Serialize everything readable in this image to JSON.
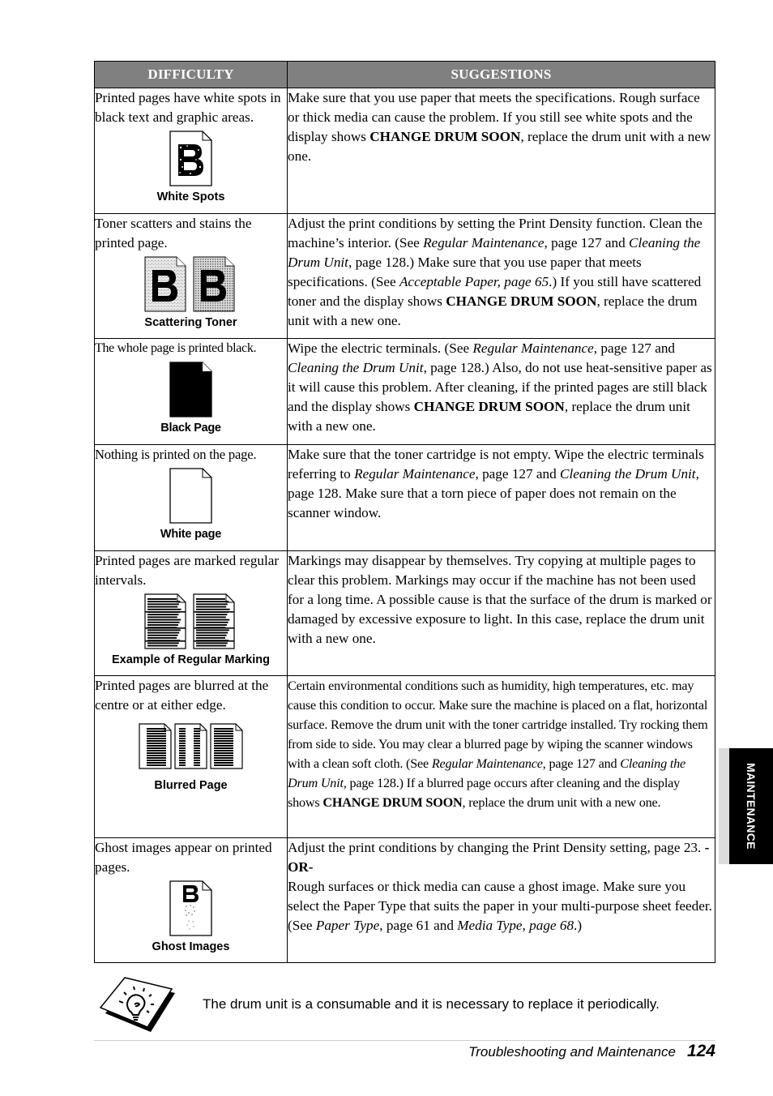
{
  "table": {
    "headers": {
      "difficulty": "DIFFICULTY",
      "suggestions": "SUGGESTIONS"
    },
    "rows": [
      {
        "difficulty": "Printed pages have white spots in black text and graphic areas.",
        "figure_caption": "White Spots",
        "figure_icon": "white-spots-page-icon",
        "suggestion": [
          {
            "t": "Make sure that you use paper that meets the specifications. Rough surface or thick media can cause the problem. If you still see white spots and the display shows "
          },
          {
            "t": "CHANGE DRUM SOON",
            "s": "b"
          },
          {
            "t": ", replace the drum unit with a new one."
          }
        ]
      },
      {
        "difficulty": "Toner scatters and stains the printed page.",
        "figure_caption": "Scattering Toner",
        "figure_icon": "scattering-toner-pages-icon",
        "suggestion": [
          {
            "t": "Adjust the print conditions by setting the Print Density function. Clean the machine’s interior. (See "
          },
          {
            "t": "Regular Maintenance",
            "s": "i"
          },
          {
            "t": ", page 127 and "
          },
          {
            "t": "Cleaning the Drum Unit",
            "s": "i"
          },
          {
            "t": ", page 128.) Make sure that you use paper that meets specifications. (See "
          },
          {
            "t": "Acceptable Paper, page 65",
            "s": "i"
          },
          {
            "t": ".) If you still have scattered toner and the display shows "
          },
          {
            "t": "CHANGE DRUM SOON",
            "s": "b"
          },
          {
            "t": ", replace the drum unit with a new one."
          }
        ]
      },
      {
        "difficulty": "The whole page is printed black.",
        "figure_caption": "Black Page",
        "figure_icon": "black-page-icon",
        "suggestion": [
          {
            "t": "Wipe the electric terminals. (See "
          },
          {
            "t": "Regular Maintenance",
            "s": "i"
          },
          {
            "t": ", page 127 and "
          },
          {
            "t": "Cleaning the Drum Unit",
            "s": "i"
          },
          {
            "t": ", page 128.) Also, do not use heat-sensitive paper as it will cause this problem. After cleaning, if the printed pages are still black and the display shows "
          },
          {
            "t": "CHANGE DRUM SOON",
            "s": "b"
          },
          {
            "t": ", replace the drum unit with a new one."
          }
        ]
      },
      {
        "difficulty": "Nothing is printed on the page.",
        "figure_caption": "White page",
        "figure_icon": "white-page-icon",
        "suggestion": [
          {
            "t": "Make sure that the toner cartridge is not empty. Wipe the electric terminals referring to "
          },
          {
            "t": "Regular Maintenance",
            "s": "i"
          },
          {
            "t": ", page 127 and "
          },
          {
            "t": "Cleaning the Drum Unit",
            "s": "i"
          },
          {
            "t": ", page 128. Make sure that a torn piece of paper does not remain on the scanner window."
          }
        ]
      },
      {
        "difficulty": "Printed pages are marked regular intervals.",
        "figure_caption": "Example of Regular Marking",
        "figure_icon": "regular-marking-pages-icon",
        "suggestion": [
          {
            "t": "Markings may disappear by themselves. Try copying at multiple pages to clear this problem. Markings may occur if the machine has not been used for a long time. A possible cause is that the surface of the drum is marked or damaged by excessive exposure to light. In this case, replace the drum unit with a new one."
          }
        ]
      },
      {
        "difficulty": "Printed pages are blurred at the centre or at either edge.",
        "figure_caption": "Blurred Page",
        "figure_icon": "blurred-pages-icon",
        "suggestion": [
          {
            "t": "Certain environmental conditions such as humidity, high temperatures, etc. may cause this condition to occur. Make sure the machine is placed on a flat, horizontal surface. Remove the drum unit with the toner cartridge installed. Try rocking them from side to side. You may clear a blurred page by wiping the scanner windows with a clean soft cloth. (See "
          },
          {
            "t": "Regular Maintenance",
            "s": "i"
          },
          {
            "t": ", page 127 and "
          },
          {
            "t": "Cleaning the Drum Unit",
            "s": "i"
          },
          {
            "t": ", page 128.) If a blurred page occurs after cleaning and the display shows "
          },
          {
            "t": "CHANGE DRUM SOON",
            "s": "b"
          },
          {
            "t": ", replace the drum unit with a new one."
          }
        ]
      },
      {
        "difficulty": "Ghost images appear on printed pages.",
        "figure_caption": "Ghost Images",
        "figure_icon": "ghost-image-page-icon",
        "suggestion": [
          {
            "t": "Adjust the print conditions by changing the Print Density setting, page 23. "
          },
          {
            "t": "-OR-",
            "s": "b"
          },
          {
            "t": "\n",
            "s": "br"
          },
          {
            "t": "Rough surfaces or thick media can cause a ghost image. Make sure you select the Paper Type that suits the paper in your multi-purpose sheet feeder. (See "
          },
          {
            "t": "Paper Type",
            "s": "i"
          },
          {
            "t": ", page 61 and "
          },
          {
            "t": "Media Type, page 68",
            "s": "i"
          },
          {
            "t": ".)"
          }
        ]
      }
    ]
  },
  "note": {
    "icon": "lightbulb-tip-icon",
    "text": "The drum unit is a consumable and it is necessary to replace it periodically."
  },
  "footer": {
    "section_title": "Troubleshooting and Maintenance",
    "page_number": "124"
  },
  "side_tab": {
    "label": "MAINTENANCE"
  }
}
